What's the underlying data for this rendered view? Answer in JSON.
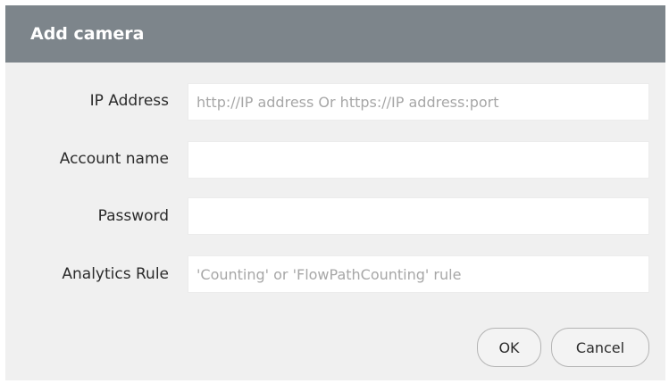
{
  "dialog": {
    "title": "Add camera"
  },
  "form": {
    "fields": [
      {
        "label": "IP Address",
        "value": "",
        "placeholder": "http://IP address Or https://IP address:port"
      },
      {
        "label": "Account name",
        "value": "",
        "placeholder": ""
      },
      {
        "label": "Password",
        "value": "",
        "placeholder": ""
      },
      {
        "label": "Analytics Rule",
        "value": "",
        "placeholder": "'Counting' or 'FlowPathCounting' rule"
      }
    ]
  },
  "buttons": {
    "ok_label": "OK",
    "cancel_label": "Cancel"
  },
  "colors": {
    "titlebar_bg": "#7d858b",
    "dialog_bg": "#f0f0f0",
    "field_bg": "#ffffff"
  }
}
